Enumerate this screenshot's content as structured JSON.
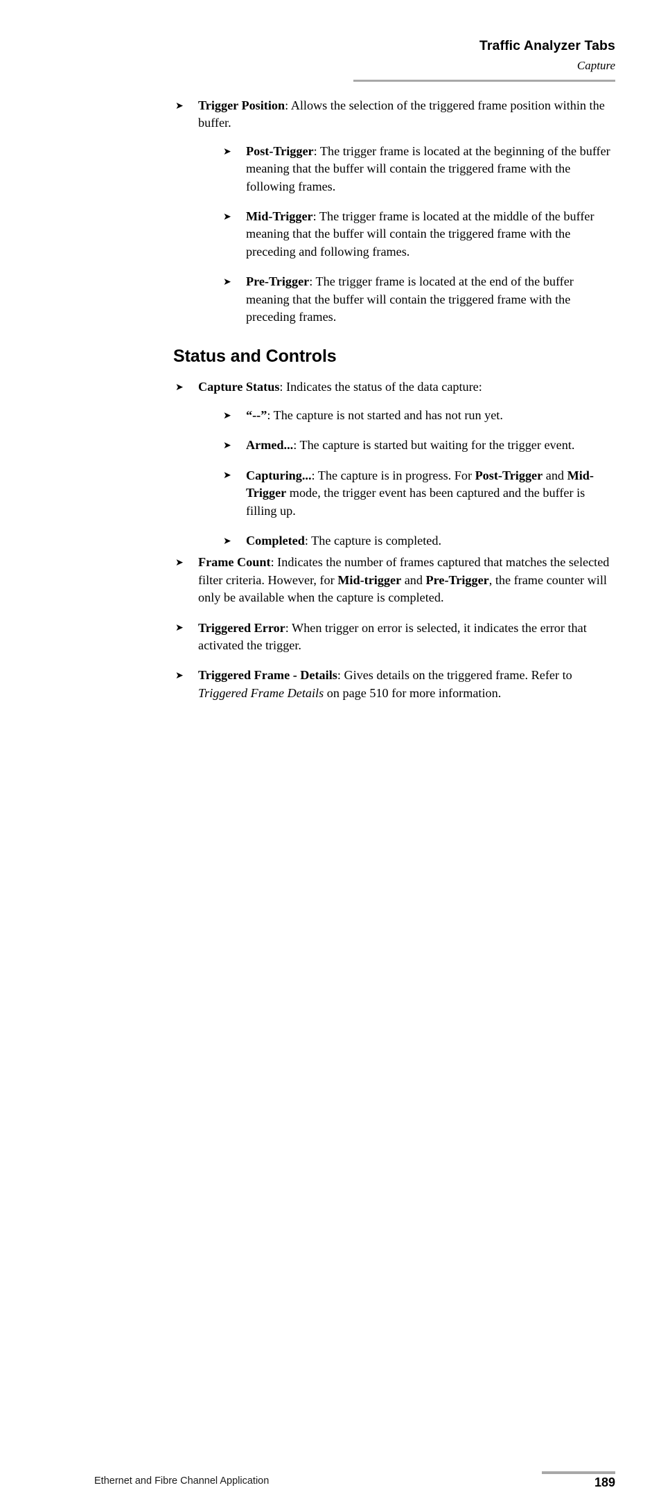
{
  "header": {
    "title": "Traffic Analyzer Tabs",
    "subtitle": "Capture",
    "rule_color": "#a8a8a8"
  },
  "footer": {
    "left_text": "Ethernet and Fibre Channel Application",
    "page_number": "189",
    "rule_color": "#a8a8a8"
  },
  "bullet_glyph": "➤",
  "content": {
    "trigger_position": {
      "term": "Trigger Position",
      "body": ": Allows the selection of the triggered frame position within the buffer.",
      "children": [
        {
          "term": "Post-Trigger",
          "body": ": The trigger frame is located at the beginning of the buffer meaning that the buffer will contain the triggered frame with the following frames."
        },
        {
          "term": "Mid-Trigger",
          "body": ": The trigger frame is located at the middle of the buffer meaning that the buffer will contain the triggered frame with the preceding and following frames."
        },
        {
          "term": "Pre-Trigger",
          "body": ": The trigger frame is located at the end of the buffer meaning that the buffer will contain the triggered frame with the preceding frames."
        }
      ]
    },
    "section_heading": "Status and Controls",
    "capture_status": {
      "term": "Capture Status",
      "body": ": Indicates the status of the data capture:",
      "children": [
        {
          "term": "“--”",
          "body": ": The capture is not started and has not run yet."
        },
        {
          "term": "Armed...",
          "body": ": The capture is started but waiting for the trigger event."
        },
        {
          "term": "Capturing...",
          "body_1": ": The capture is in progress. For ",
          "bold_1": "Post-Trigger",
          "body_2": " and ",
          "bold_2": "Mid-Trigger",
          "body_3": " mode, the trigger event has been captured and the buffer is filling up."
        },
        {
          "term": "Completed",
          "body": ": The capture is completed."
        }
      ]
    },
    "frame_count": {
      "term": "Frame Count",
      "body_1": ": Indicates the number of frames captured that matches the selected filter criteria. However, for ",
      "bold_1": "Mid-trigger",
      "body_2": " and ",
      "bold_2": "Pre-Trigger",
      "body_3": ", the frame counter will only be available when the capture is completed."
    },
    "triggered_error": {
      "term": "Triggered Error",
      "body": ": When trigger on error is selected, it indicates the error that activated the trigger."
    },
    "triggered_frame_details": {
      "term": "Triggered Frame - Details",
      "body_1": ": Gives details on the triggered frame. Refer to ",
      "italic_1": "Triggered Frame Details",
      "body_2": " on page 510 for more information."
    }
  }
}
